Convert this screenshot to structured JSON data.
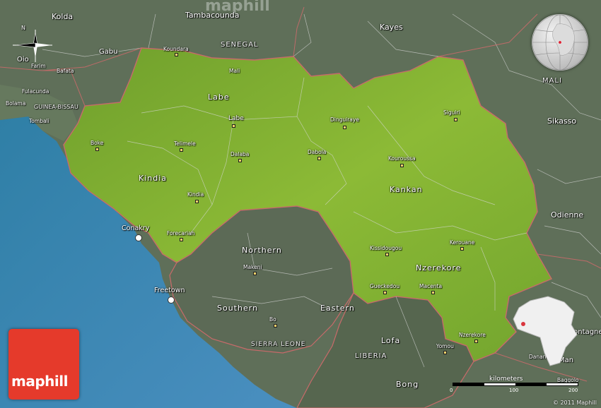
{
  "map": {
    "watermark": "maphill",
    "brand": "maphill",
    "copyright": "© 2011 Maphill",
    "scale": {
      "label": "kilometers",
      "ticks": [
        "0",
        "100",
        "200"
      ]
    },
    "compass": {
      "north": "N"
    },
    "regions": [
      "Labe",
      "Kindia",
      "Kankan",
      "Northern",
      "Southern",
      "Eastern",
      "Nzerekore",
      "Lofa",
      "Bong"
    ],
    "countries": [
      "SENEGAL",
      "MALI",
      "GUINEA-BISSAU",
      "SIERRA LEONE",
      "LIBERIA"
    ],
    "capitals": [
      "Conakry",
      "Freetown"
    ],
    "cities": [
      "Kolda",
      "Tambacounda",
      "Kayes",
      "Gabu",
      "Oio",
      "Bafata",
      "Farim",
      "Fulacunda",
      "Bolama",
      "Tombali",
      "Koundara",
      "Mali",
      "Labe",
      "Siguiri",
      "Dinguiraye",
      "Boke",
      "Telimele",
      "Dalaba",
      "Dabola",
      "Kouroussa",
      "Kindia",
      "Forecariah",
      "Sikasso",
      "Odienne",
      "Kerouane",
      "Kissidougou",
      "Gueckedou",
      "Macenta",
      "Makeni",
      "Nzerekore",
      "Yomou",
      "Bo",
      "Dix-huit Montagnes",
      "Man",
      "Danane",
      "Baggolo"
    ],
    "colors": {
      "sea": "#3b88b8",
      "guinea": "#7fae2e",
      "land": "#5e6e58",
      "border": "#c86a6a",
      "logo": "#e53a2b"
    }
  }
}
